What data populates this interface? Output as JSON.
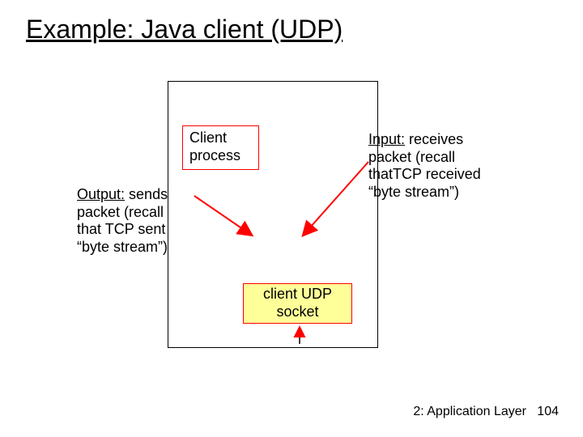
{
  "title": "Example: Java client (UDP)",
  "clientBox": {
    "line1": "Client",
    "line2": "process"
  },
  "output": {
    "label": "Output:",
    "rest1": " sends",
    "line2": "packet (recall",
    "line3": "that TCP sent",
    "line4": "“byte stream”)"
  },
  "input": {
    "label": "Input:",
    "rest1": " receives",
    "line2": "packet (recall",
    "line3": "thatTCP received",
    "line4": "“byte stream”)"
  },
  "socket": {
    "line1": "client UDP",
    "line2": "socket"
  },
  "footer": {
    "layer": "2: Application Layer",
    "page": "104"
  }
}
